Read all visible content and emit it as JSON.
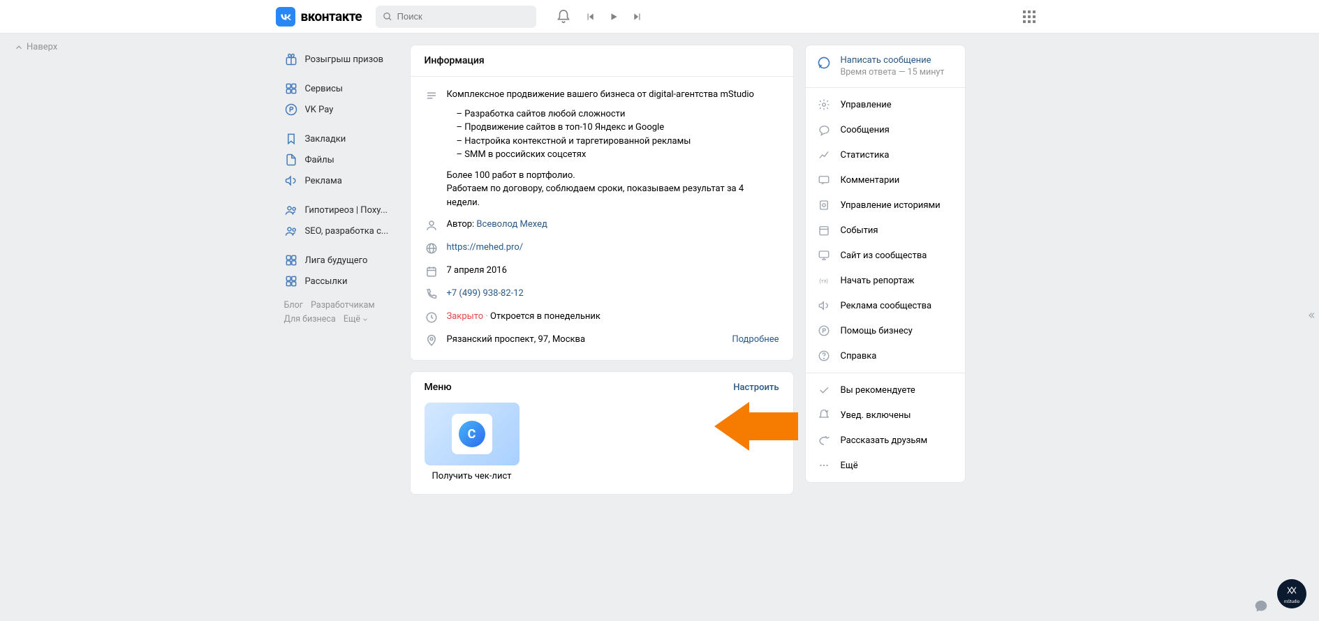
{
  "header": {
    "logo_text": "вконтакте",
    "search_placeholder": "Поиск"
  },
  "to_top": "Наверх",
  "nav": {
    "items1": [
      {
        "icon": "gift",
        "label": "Розыгрыш призов"
      }
    ],
    "items2": [
      {
        "icon": "services",
        "label": "Сервисы"
      },
      {
        "icon": "vkpay",
        "label": "VK Pay"
      }
    ],
    "items3": [
      {
        "icon": "bookmark",
        "label": "Закладки"
      },
      {
        "icon": "file",
        "label": "Файлы"
      },
      {
        "icon": "megaphone",
        "label": "Реклама"
      }
    ],
    "items4": [
      {
        "icon": "group",
        "label": "Гипотиреоз | Поху..."
      },
      {
        "icon": "group",
        "label": "SEO, разработка с..."
      }
    ],
    "items5": [
      {
        "icon": "services",
        "label": "Лига будущего"
      },
      {
        "icon": "services",
        "label": "Рассылки"
      }
    ]
  },
  "footer": {
    "blog": "Блог",
    "devs": "Разработчикам",
    "biz": "Для бизнеса",
    "more": "Ещё"
  },
  "info": {
    "title": "Информация",
    "description": {
      "headline": "Комплексное продвижение вашего бизнеса от digital-агентства mStudio",
      "bullets": [
        "Разработка сайтов любой сложности",
        "Продвижение сайтов в топ-10 Яндекс и Google",
        "Настройка контекстной и таргетированной рекламы",
        "SMM в российских соцсетях"
      ],
      "p1": "Более 100 работ в портфолио.",
      "p2": "Работаем по договору, соблюдаем сроки, показываем результат за 4 недели."
    },
    "author_label": "Автор:",
    "author_name": "Всеволод Мехед",
    "website": "https://mehed.pro/",
    "founded": "7 апреля 2016",
    "phone": "+7 (499) 938-82-12",
    "status_closed": "Закрыто",
    "status_dot": "·",
    "status_open": "Откроется в понедельник",
    "address": "Рязанский проспект, 97, Москва",
    "more": "Подробнее"
  },
  "menu": {
    "title": "Меню",
    "configure": "Настроить",
    "item_letter": "C",
    "item_caption": "Получить чек-лист"
  },
  "right": {
    "msg_title": "Написать сообщение",
    "msg_sub": "Время ответа — 15 минут",
    "items": [
      {
        "icon": "gear",
        "label": "Управление"
      },
      {
        "icon": "comment",
        "label": "Сообщения"
      },
      {
        "icon": "stats",
        "label": "Статистика"
      },
      {
        "icon": "comments",
        "label": "Комментарии"
      },
      {
        "icon": "stories",
        "label": "Управление историями"
      },
      {
        "icon": "calendar",
        "label": "События"
      },
      {
        "icon": "monitor",
        "label": "Сайт из сообщества"
      },
      {
        "icon": "broadcast",
        "label": "Начать репортаж"
      },
      {
        "icon": "ads",
        "label": "Реклама сообщества"
      },
      {
        "icon": "help",
        "label": "Помощь бизнесу"
      },
      {
        "icon": "faq",
        "label": "Справка"
      }
    ],
    "items2": [
      {
        "icon": "check",
        "label": "Вы рекомендуете"
      },
      {
        "icon": "bell-check",
        "label": "Увед. включены"
      },
      {
        "icon": "share",
        "label": "Рассказать друзьям"
      },
      {
        "icon": "more",
        "label": "Ещё"
      }
    ]
  },
  "fab_label": "mStudio"
}
